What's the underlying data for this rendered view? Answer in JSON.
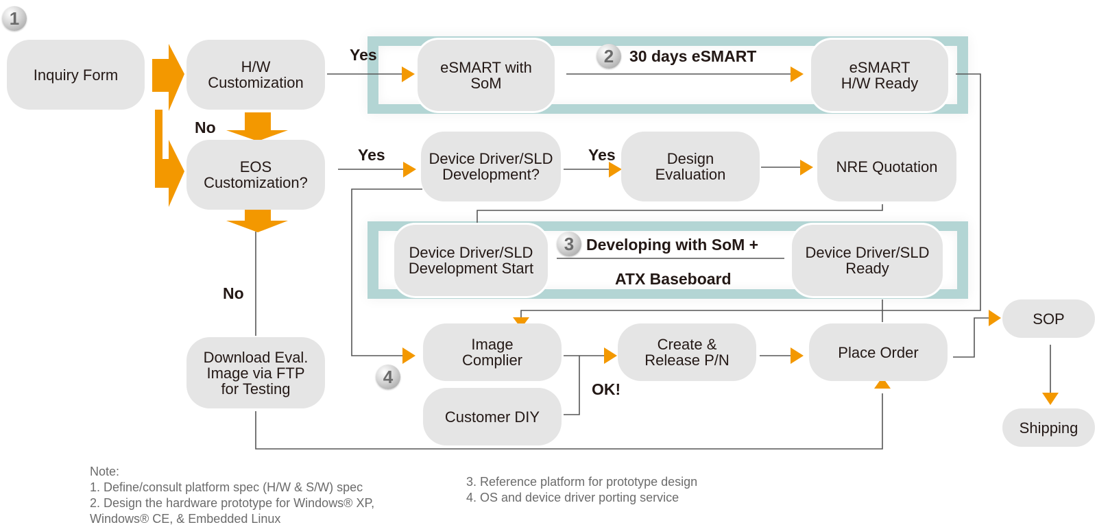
{
  "colors": {
    "arrow": "#f39800",
    "node_fill": "#e5e5e5",
    "band": "#b3d5d4",
    "line": "#555555",
    "text": "#231815",
    "note_text": "#6b6b6b"
  },
  "badges": [
    "1",
    "2",
    "3",
    "4"
  ],
  "nodes": {
    "inquiry_form": "Inquiry Form",
    "hw_customization": "H/W\nCustomization",
    "eos_customization": "EOS\nCustomization?",
    "esmart_with_som": "eSMART with\nSoM",
    "esmart_hw_ready": "eSMART\nH/W Ready",
    "dd_sld_development_q": "Device Driver/SLD\nDevelopment?",
    "design_evaluation": "Design\nEvaluation",
    "nre_quotation": "NRE Quotation",
    "dd_sld_development_start": "Device Driver/SLD\nDevelopment Start",
    "dd_sld_ready": "Device Driver/SLD\nReady",
    "download_eval_image": "Download Eval.\nImage via FTP\nfor Testing",
    "image_complier": "Image\nComplier",
    "customer_diy": "Customer DIY",
    "create_release_pn": "Create &\nRelease P/N",
    "place_order": "Place Order",
    "sop": "SOP",
    "shipping": "Shipping"
  },
  "labels": {
    "yes_hw": "Yes",
    "no_hw": "No",
    "yes_eos": "Yes",
    "yes_dd": "Yes",
    "no_eos": "No",
    "ok": "OK!"
  },
  "bands": {
    "esmart_title": "30 days eSMART",
    "dev_title_line1": "Developing with SoM +",
    "dev_title_line2": "ATX Baseboard"
  },
  "notes": {
    "heading": "Note:",
    "left": [
      "1. Define/consult platform spec (H/W & S/W) spec",
      "2. Design the hardware prototype for Windows® XP,\n    Windows® CE, & Embedded Linux"
    ],
    "right": [
      "3. Reference platform for prototype design",
      "4. OS and device driver porting service"
    ]
  }
}
